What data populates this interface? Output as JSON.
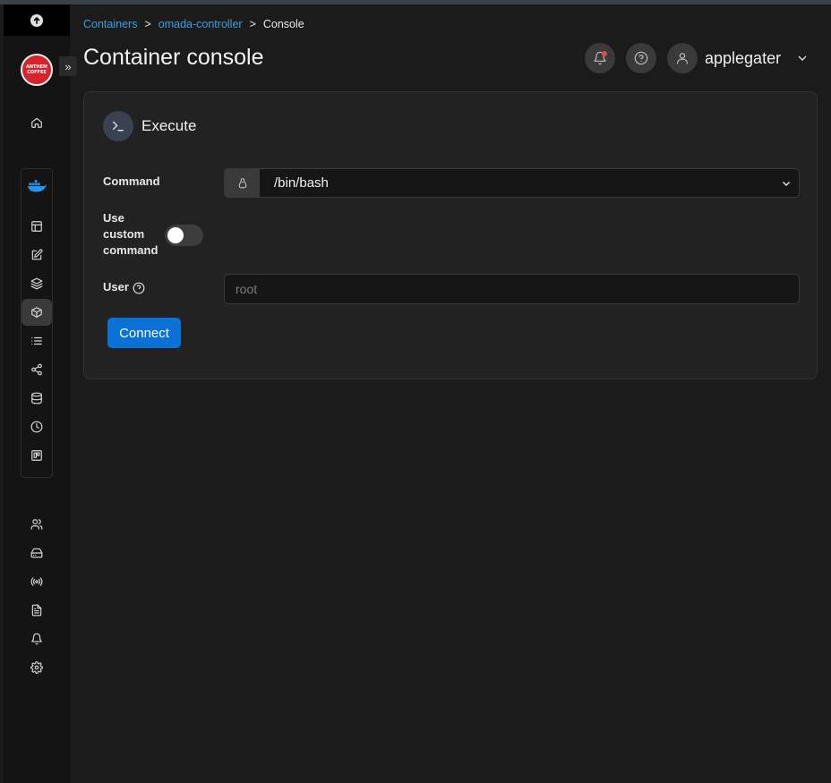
{
  "breadcrumb": {
    "item1": "Containers",
    "item2": "omada-controller",
    "current": "Console",
    "separator": ">"
  },
  "page": {
    "title": "Container console"
  },
  "header": {
    "username": "applegater"
  },
  "card": {
    "title": "Execute",
    "command_label": "Command",
    "command_value": "/bin/bash",
    "custom_command_label_1": "Use",
    "custom_command_label_2": "custom",
    "custom_command_label_3": "command",
    "custom_command_enabled": false,
    "user_label": "User",
    "user_placeholder": "root",
    "connect_label": "Connect"
  },
  "logo": {
    "line1": "ANTHEM",
    "line2": "COFFEE"
  },
  "colors": {
    "accent": "#0a72d6",
    "link": "#3f9fe0",
    "logo": "#d6232c",
    "notification": "#e5484d"
  },
  "sidebar": {
    "top_icons": [
      "upload-icon",
      "home-icon"
    ],
    "environment_icon": "docker-whale-icon",
    "environment_items": [
      "dashboard-icon",
      "templates-icon",
      "stacks-icon",
      "containers-icon",
      "images-icon",
      "networks-icon",
      "volumes-icon",
      "events-icon",
      "host-icon"
    ],
    "settings_items": [
      "users-icon",
      "environments-icon",
      "registries-icon",
      "logs-icon",
      "notifications-icon",
      "settings-icon"
    ]
  }
}
